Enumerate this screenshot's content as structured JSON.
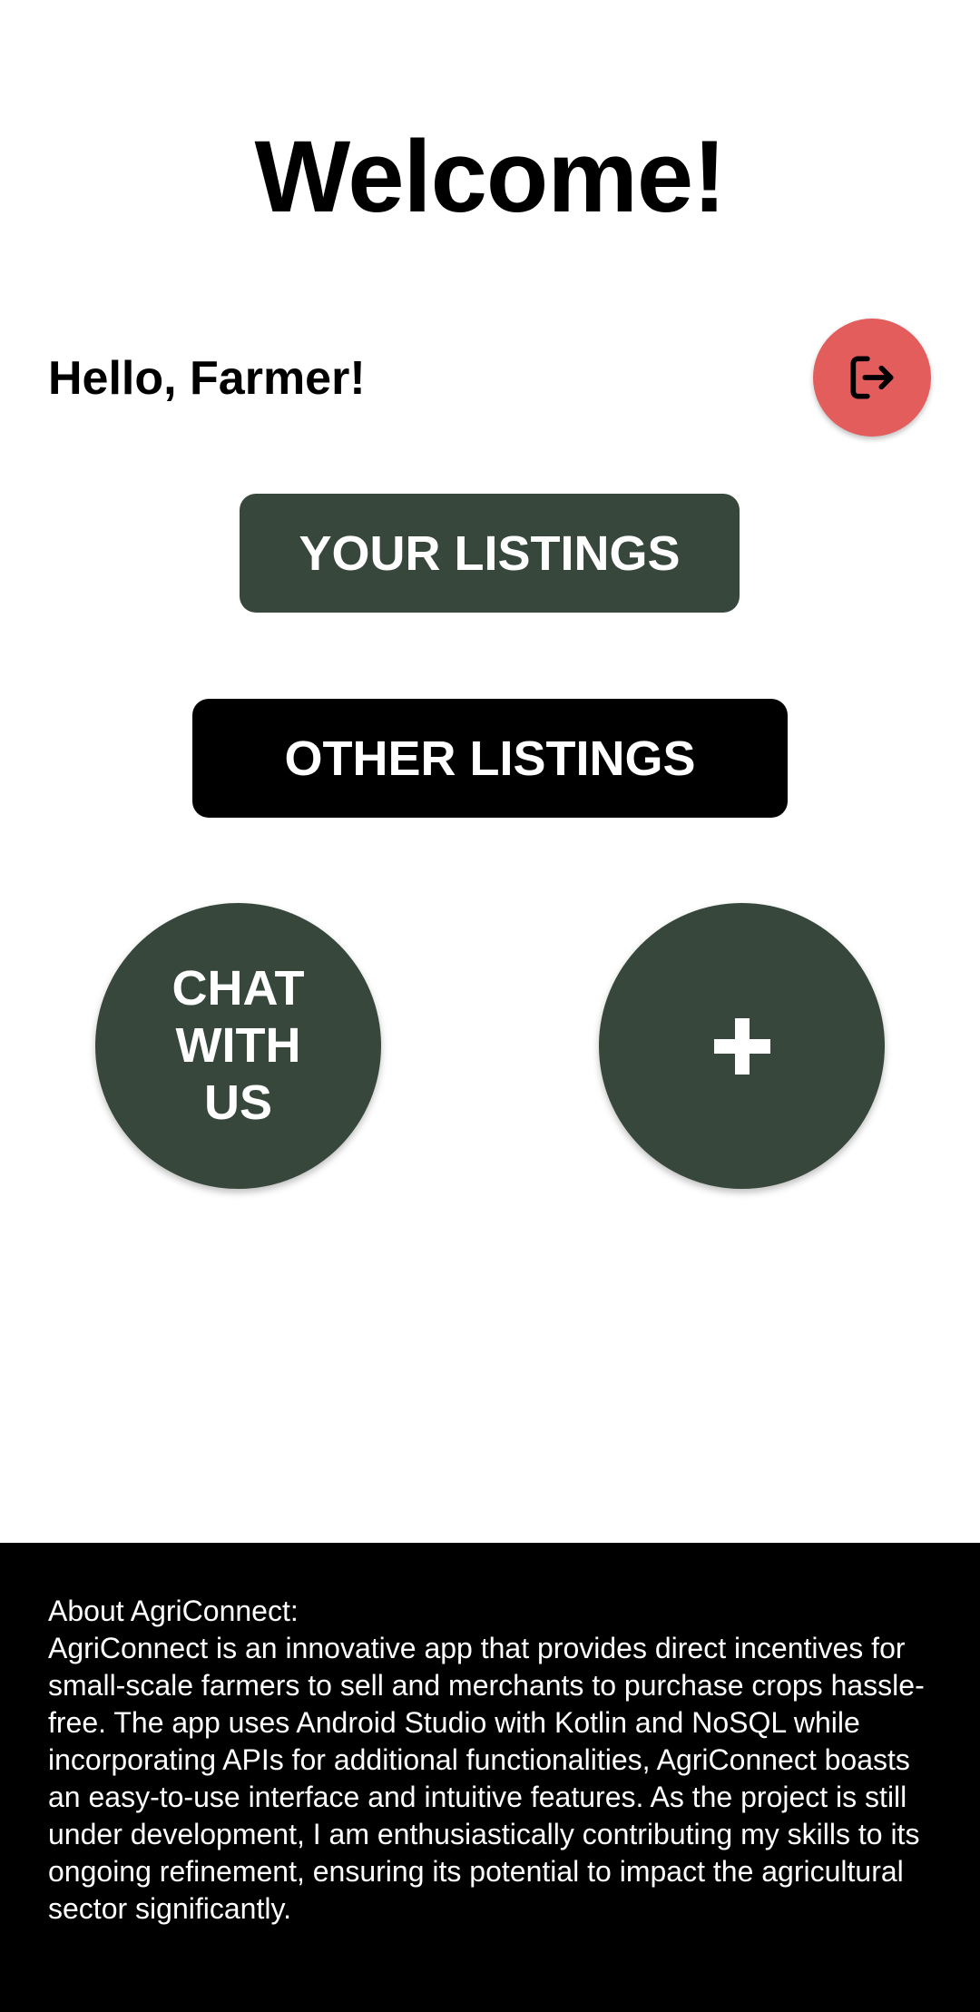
{
  "header": {
    "title": "Welcome!"
  },
  "greeting": "Hello, Farmer!",
  "logout": {
    "icon": "logout-icon",
    "color": "#E35D5D"
  },
  "buttons": {
    "your_listings": "YOUR LISTINGS",
    "other_listings": "OTHER LISTINGS",
    "chat": "CHAT WITH US",
    "add": "+"
  },
  "colors": {
    "primary_green": "#37473C",
    "black": "#000000",
    "logout_red": "#E35D5D"
  },
  "footer": {
    "heading": "About AgriConnect:",
    "body": "AgriConnect is an innovative app that provides direct incentives for small-scale farmers to sell and merchants to purchase crops hassle-free. The app uses Android Studio with Kotlin and NoSQL while incorporating APIs for additional functionalities, AgriConnect boasts an easy-to-use interface and intuitive features. As the project is still under development, I am enthusiastically contributing my skills to its ongoing refinement, ensuring its potential to impact the agricultural sector significantly."
  }
}
